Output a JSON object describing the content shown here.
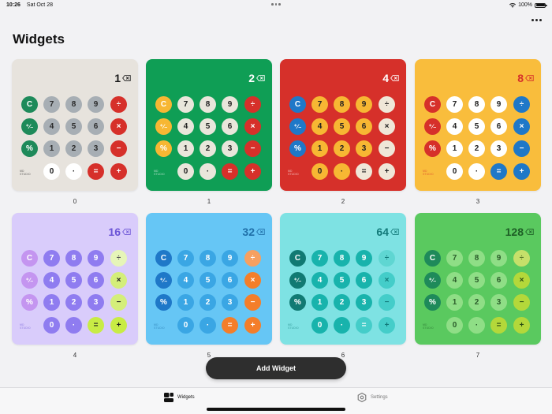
{
  "status_bar": {
    "time": "10:26",
    "date": "Sat Oct 28",
    "battery": "100%",
    "battery_level": 1.0
  },
  "page": {
    "title": "Widgets",
    "more_icon": "ellipsis-icon"
  },
  "widgets": [
    {
      "index": "0",
      "display": "1",
      "theme": {
        "bg": "#e7e3dd",
        "text": "#1a1a1a",
        "clear": "#1e8a5a",
        "pct": "#1e8a5a",
        "num": "#a7aeb4",
        "numText": "#2b2b2b",
        "zero": "#ffffff",
        "zeroText": "#222222",
        "op": "#d6302a",
        "opText": "#ffffff",
        "eq": "#d6302a",
        "eqText": "#ffffff",
        "plus": "#d6302a",
        "plusText": "#ffffff",
        "opTop": "#d6302a",
        "opTopText": "#ffffff"
      }
    },
    {
      "index": "1",
      "display": "2",
      "theme": {
        "bg": "#0f9e55",
        "text": "#ffffff",
        "clear": "#f7b733",
        "pct": "#f7b733",
        "num": "#e9e6db",
        "numText": "#222222",
        "zero": "#e9e6db",
        "zeroText": "#222222",
        "op": "#d6302a",
        "opText": "#ffffff",
        "eq": "#d6302a",
        "eqText": "#ffffff",
        "plus": "#d6302a",
        "plusText": "#ffffff",
        "opTop": "#d6302a",
        "opTopText": "#ffffff"
      }
    },
    {
      "index": "2",
      "display": "4",
      "theme": {
        "bg": "#d6302a",
        "text": "#ffffff",
        "clear": "#1f78c8",
        "pct": "#1f78c8",
        "num": "#f7b733",
        "numText": "#222222",
        "zero": "#f7b733",
        "zeroText": "#222222",
        "op": "#efe7d8",
        "opText": "#222222",
        "eq": "#efe7d8",
        "eqText": "#222222",
        "plus": "#efe7d8",
        "plusText": "#222222",
        "opTop": "#efe7d8",
        "opTopText": "#222222"
      }
    },
    {
      "index": "3",
      "display": "8",
      "theme": {
        "bg": "#f9bd3c",
        "text": "#d6302a",
        "clear": "#d6302a",
        "pct": "#d6302a",
        "num": "#ffffff",
        "numText": "#222222",
        "zero": "#ffffff",
        "zeroText": "#222222",
        "op": "#1f78c8",
        "opText": "#ffffff",
        "eq": "#1f78c8",
        "eqText": "#ffffff",
        "plus": "#1f78c8",
        "plusText": "#ffffff",
        "opTop": "#1f78c8",
        "opTopText": "#ffffff"
      }
    },
    {
      "index": "4",
      "display": "16",
      "theme": {
        "bg": "#d9ccfb",
        "text": "#6b54d6",
        "clear": "#c495f0",
        "pct": "#c495f0",
        "num": "#8f7cf0",
        "numText": "#ffffff",
        "zero": "#8f7cf0",
        "zeroText": "#ffffff",
        "op": "#d4ee7a",
        "opText": "#222222",
        "eq": "#c8ec45",
        "eqText": "#222222",
        "plus": "#c8ec45",
        "plusText": "#222222",
        "opTop": "#e6f5b8",
        "opTopText": "#555555"
      }
    },
    {
      "index": "5",
      "display": "32",
      "theme": {
        "bg": "#66c6f5",
        "text": "#1f6fa8",
        "clear": "#1f78c8",
        "pct": "#1f78c8",
        "num": "#3aa6e4",
        "numText": "#ffffff",
        "zero": "#3aa6e4",
        "zeroText": "#ffffff",
        "op": "#f47e2a",
        "opText": "#ffffff",
        "eq": "#f47e2a",
        "eqText": "#ffffff",
        "plus": "#f47e2a",
        "plusText": "#ffffff",
        "opTop": "#f6a060",
        "opTopText": "#ffffff"
      }
    },
    {
      "index": "6",
      "display": "64",
      "theme": {
        "bg": "#7ee2e3",
        "text": "#127a7a",
        "clear": "#117a73",
        "pct": "#117a73",
        "num": "#18b3ac",
        "numText": "#ffffff",
        "zero": "#18b3ac",
        "zeroText": "#ffffff",
        "op": "#44cdc9",
        "opText": "#127a7a",
        "eq": "#44cdc9",
        "eqText": "#ffffff",
        "plus": "#44cdc9",
        "plusText": "#127a7a",
        "opTop": "#5fd6d2",
        "opTopText": "#127a7a"
      }
    },
    {
      "index": "7",
      "display": "128",
      "theme": {
        "bg": "#5ac95f",
        "text": "#1d5e25",
        "clear": "#1e8a5a",
        "pct": "#1e8a5a",
        "num": "#8fde86",
        "numText": "#2b5c2b",
        "zero": "#8fde86",
        "zeroText": "#2b5c2b",
        "op": "#b4d83a",
        "opText": "#2b4d14",
        "eq": "#b4d83a",
        "eqText": "#2b4d14",
        "plus": "#b4d83a",
        "plusText": "#2b4d14",
        "opTop": "#c6e06a",
        "opTopText": "#5a7a2a"
      }
    }
  ],
  "keys": [
    [
      "C",
      "7",
      "8",
      "9",
      "÷"
    ],
    [
      "⁺∕₋",
      "4",
      "5",
      "6",
      "×"
    ],
    [
      "%",
      "1",
      "2",
      "3",
      "−"
    ],
    [
      "",
      "0",
      "·",
      "=",
      "+"
    ]
  ],
  "brand": "MD STUDIO",
  "add_widget_label": "Add Widget",
  "tabs": [
    {
      "label": "Widgets",
      "icon": "widgets-icon",
      "selected": true
    },
    {
      "label": "Settings",
      "icon": "gear-icon",
      "selected": false
    }
  ]
}
